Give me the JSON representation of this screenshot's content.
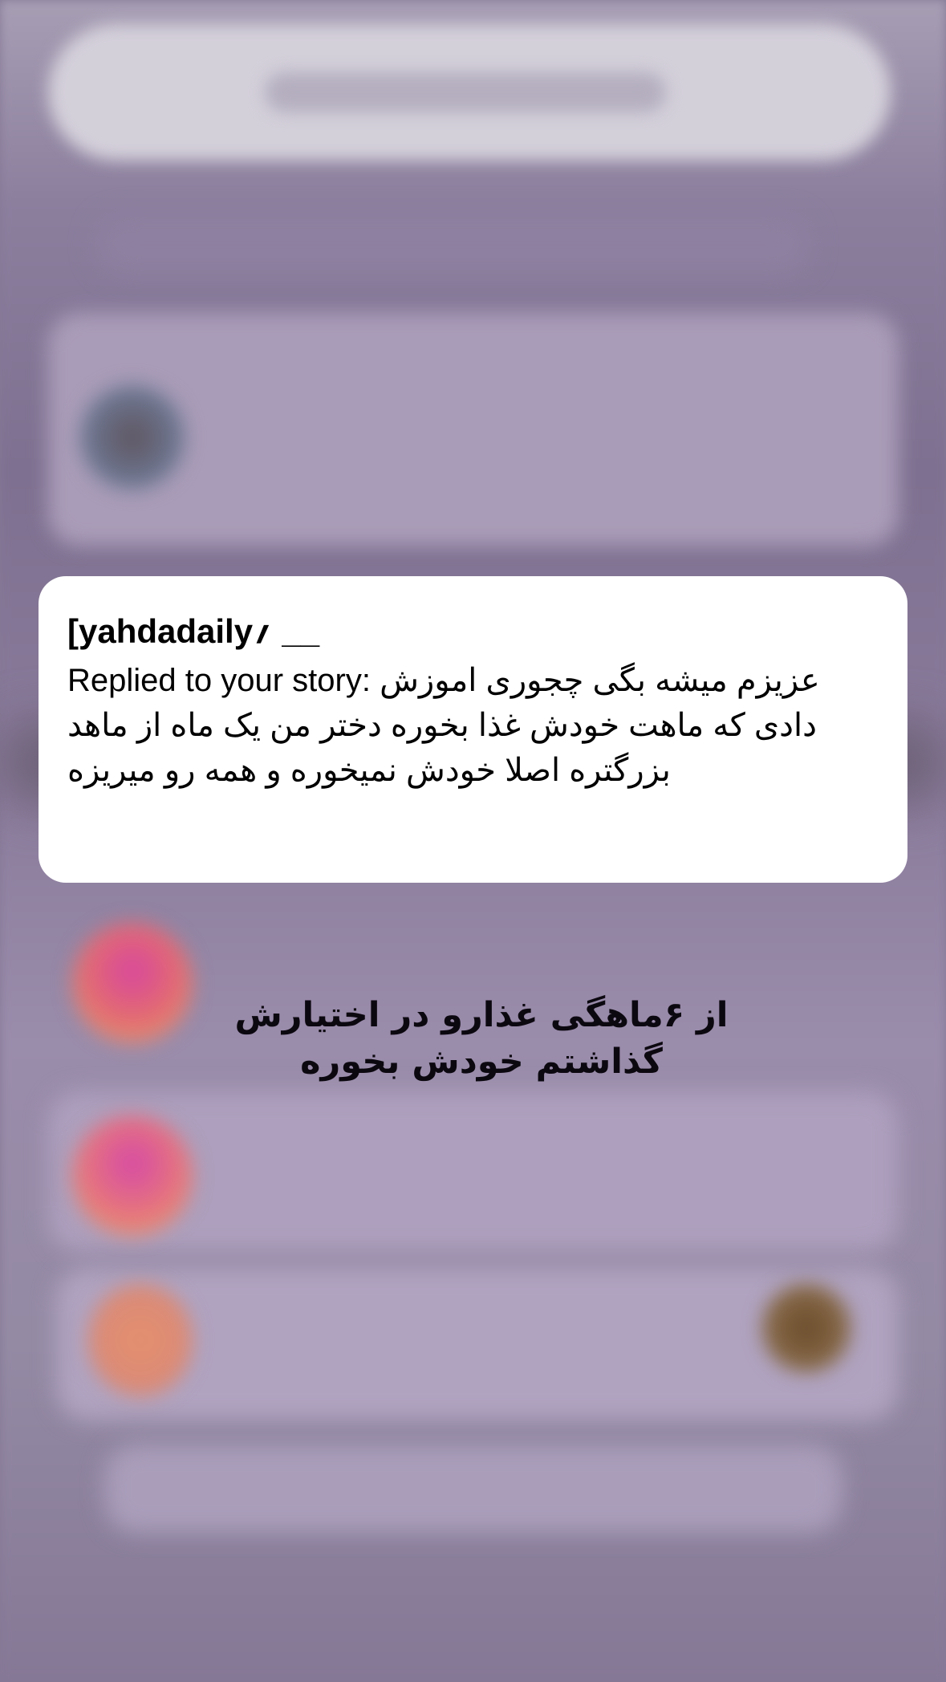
{
  "notification": {
    "sender": "[yahdadaily؍ __",
    "body": "Replied to your story: عزیزم میشه بگی چجوری اموزش دادی که ماهت خودش غذا بخوره دختر من یک ماه از ماهد بزرگتره اصلا خودش نمیخوره و همه رو میریزه"
  },
  "caption": {
    "line1": "از ۶ماهگی غذارو در اختیارش",
    "line2": "گذاشتم خودش بخوره"
  },
  "colors": {
    "background": "#857896",
    "card": "#ffffff",
    "text": "#000000"
  }
}
